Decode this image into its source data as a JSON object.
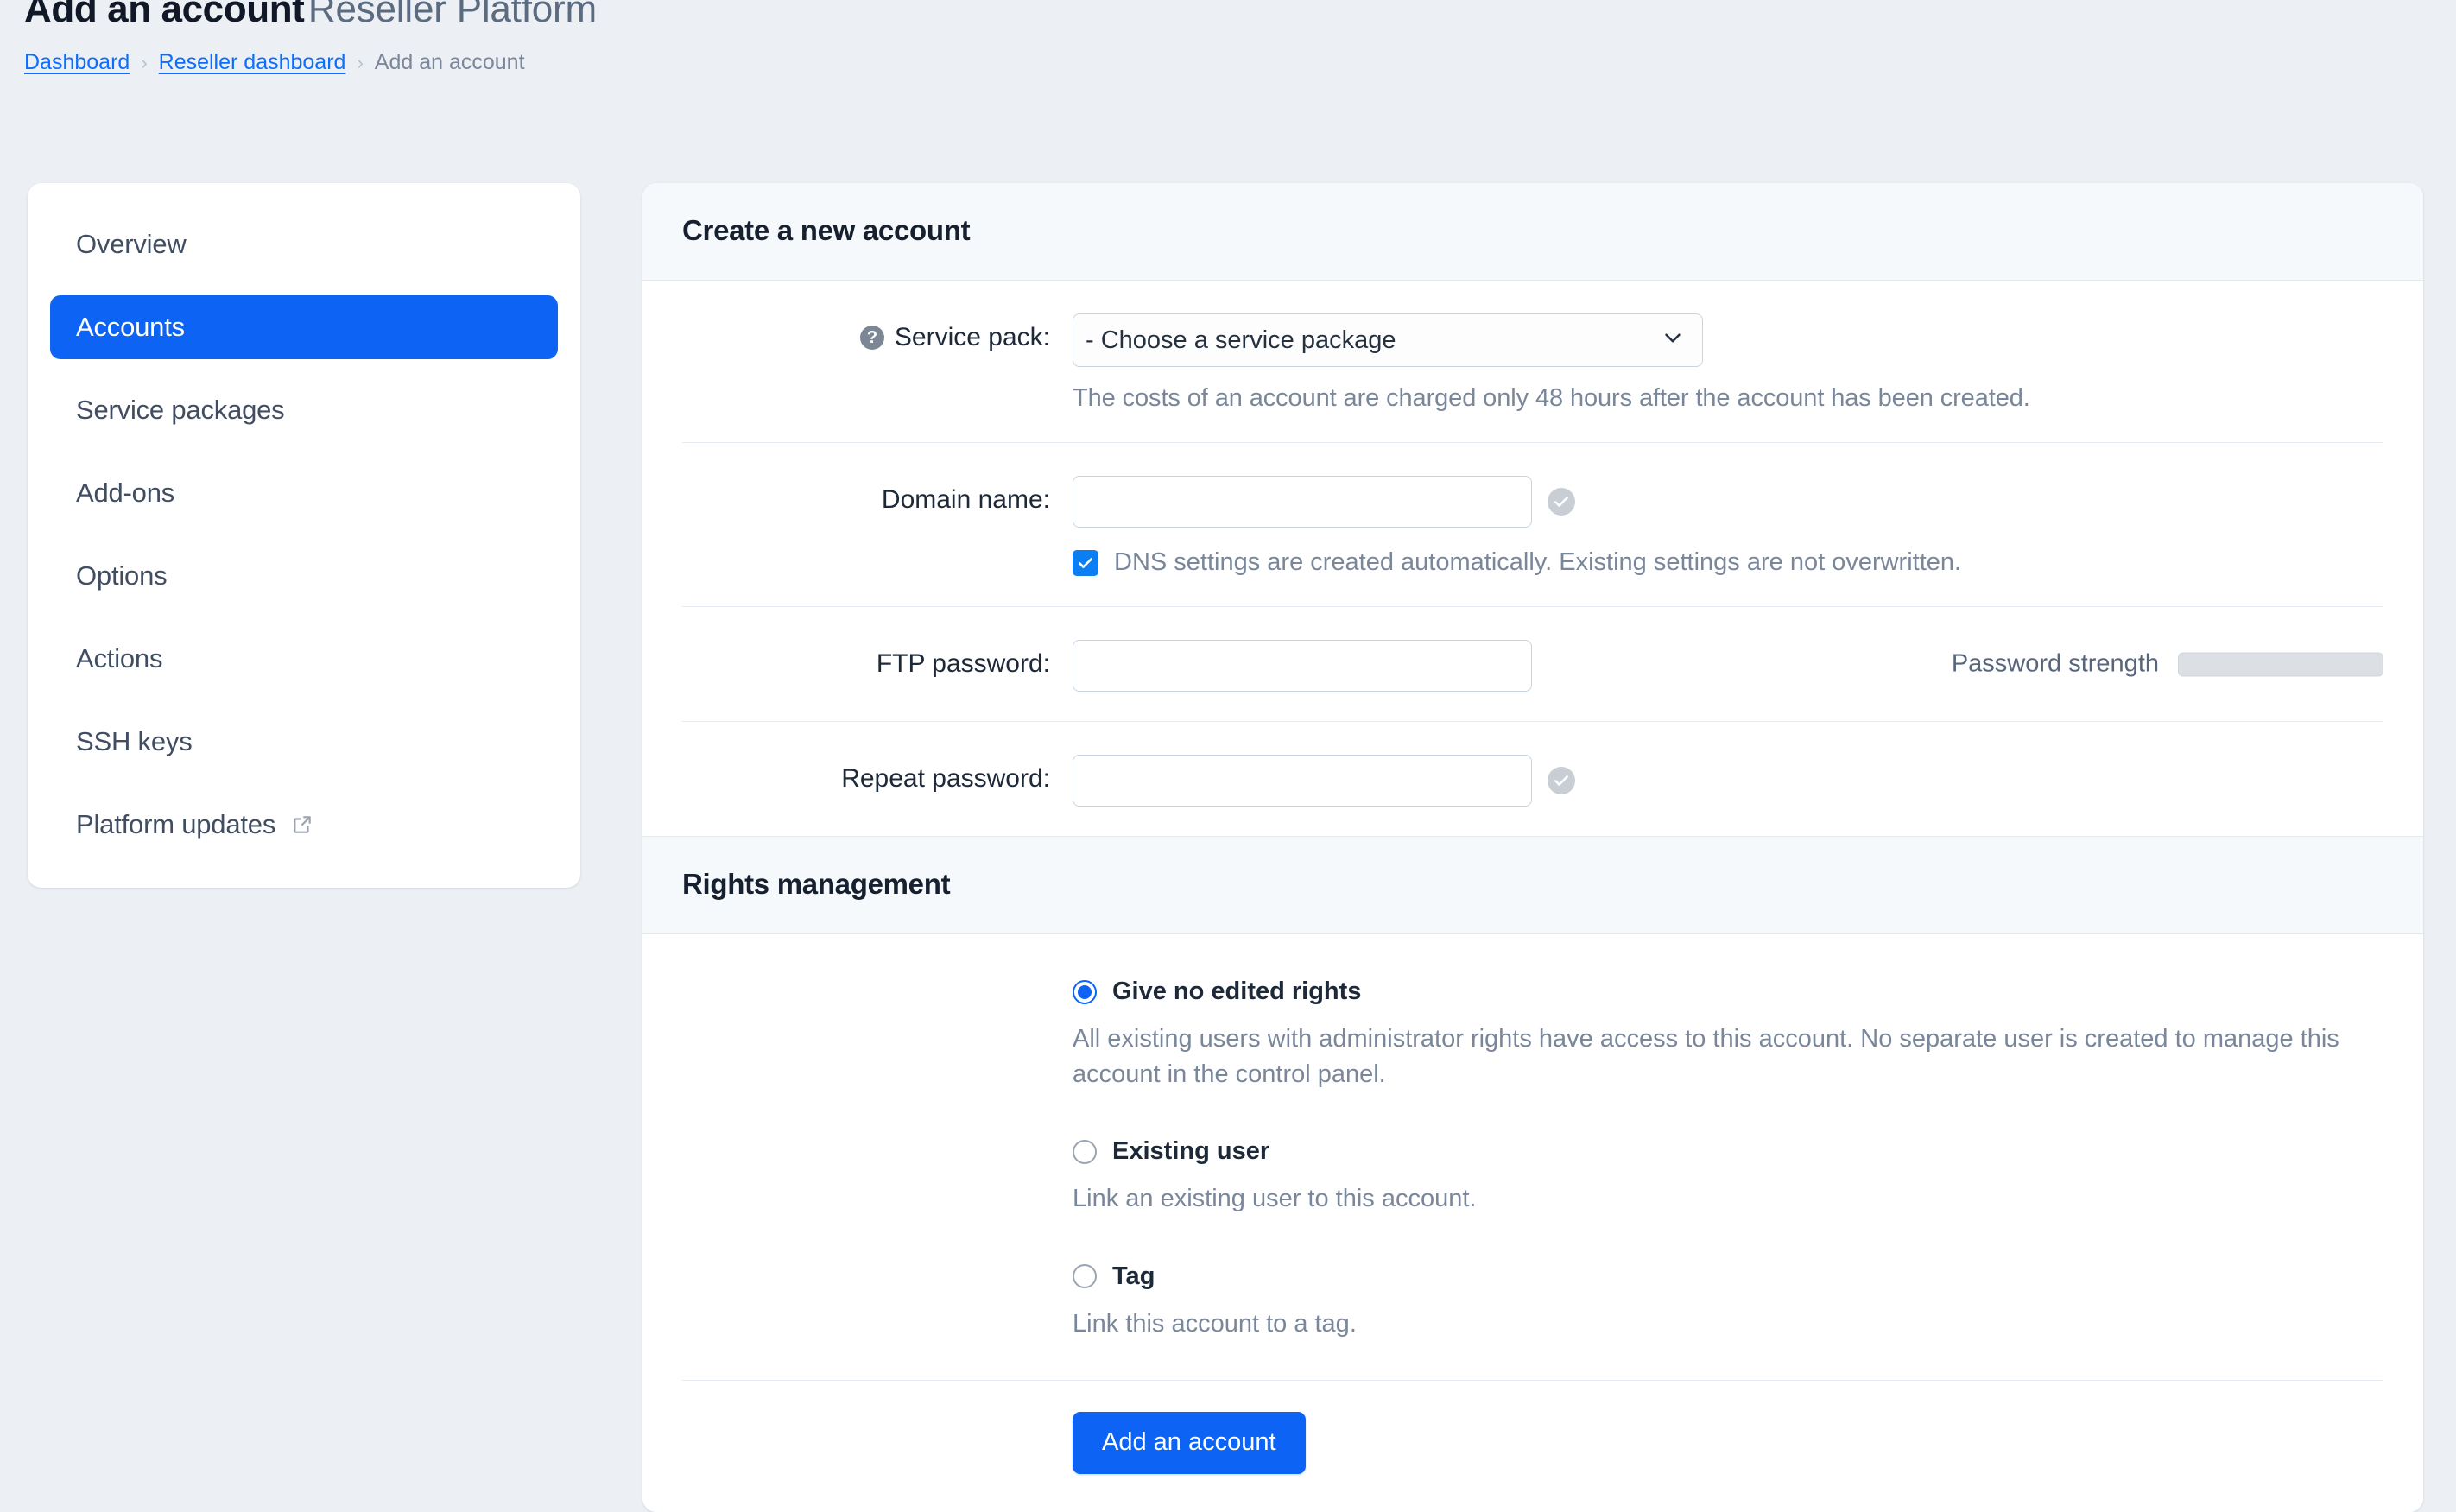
{
  "header": {
    "title": "Add an account",
    "subtitle": "Reseller Platform",
    "breadcrumb": [
      {
        "label": "Dashboard",
        "link": true
      },
      {
        "label": "Reseller dashboard",
        "link": true
      },
      {
        "label": "Add an account",
        "link": false
      }
    ],
    "separator": "›"
  },
  "sidebar": {
    "items": [
      {
        "label": "Overview",
        "active": false,
        "external": false
      },
      {
        "label": "Accounts",
        "active": true,
        "external": false
      },
      {
        "label": "Service packages",
        "active": false,
        "external": false
      },
      {
        "label": "Add-ons",
        "active": false,
        "external": false
      },
      {
        "label": "Options",
        "active": false,
        "external": false
      },
      {
        "label": "Actions",
        "active": false,
        "external": false
      },
      {
        "label": "SSH keys",
        "active": false,
        "external": false
      },
      {
        "label": "Platform updates",
        "active": false,
        "external": true
      }
    ]
  },
  "create_account": {
    "section_title": "Create a new account",
    "service_pack": {
      "label": "Service pack:",
      "help_icon": "question-mark-icon",
      "selected": "- Choose a service package",
      "options": [
        "- Choose a service package"
      ],
      "note": "The costs of an account are charged only 48 hours after the account has been created."
    },
    "domain_name": {
      "label": "Domain name:",
      "value": "",
      "placeholder": "",
      "valid_icon": "check-circle-icon",
      "dns_checkbox": {
        "checked": true,
        "label": "DNS settings are created automatically. Existing settings are not overwritten."
      }
    },
    "ftp_password": {
      "label": "FTP password:",
      "value": "",
      "placeholder": "",
      "strength_label": "Password strength",
      "strength_value": 0
    },
    "repeat_password": {
      "label": "Repeat password:",
      "value": "",
      "placeholder": "",
      "valid_icon": "check-circle-icon"
    }
  },
  "rights_management": {
    "section_title": "Rights management",
    "options": [
      {
        "title": "Give no edited rights",
        "description": "All existing users with administrator rights have access to this account. No separate user is created to manage this account in the control panel.",
        "selected": true
      },
      {
        "title": "Existing user",
        "description": "Link an existing user to this account.",
        "selected": false
      },
      {
        "title": "Tag",
        "description": "Link this account to a tag.",
        "selected": false
      }
    ],
    "submit_label": "Add an account"
  },
  "colors": {
    "accent": "#0c63f4",
    "page_background": "#eceff3",
    "section_header_background": "#f6f9fc",
    "muted_text": "#7a879a"
  }
}
